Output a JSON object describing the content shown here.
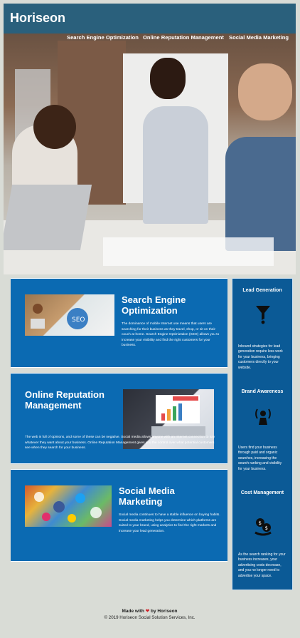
{
  "header": {
    "logo": "Horiseon",
    "nav": [
      {
        "label": "Search Engine Optimization"
      },
      {
        "label": "Online Reputation Management"
      },
      {
        "label": "Social Media Marketing"
      }
    ]
  },
  "sections": [
    {
      "title": "Search Engine Optimization",
      "body": "The dominance of mobile Internet use means that users are searching for their business as they travel, shop, or sit on their couch at home. Search Engine Optimization (SEO) allows you to increase your visibility and find the right customers for your business."
    },
    {
      "title": "Online Reputation Management",
      "body": "The web is full of opinions, and some of these can be negative. Social media allows anyone with an Internet connection to say whatever they want about your business. Online Reputation Management gives you the control over what potential customers see when they search for your business."
    },
    {
      "title": "Social Media Marketing",
      "body": "Social media continues to have a stable influence on buying habits. Social media marketing helps you determine which platforms are suited to your brand, using analytics to find the right markets and increase your lead generation."
    }
  ],
  "aside": [
    {
      "title": "Lead Generation",
      "icon": "lead-generation-icon",
      "text": "Inbound strategies for lead generation require less work for your business, bringing customers directly to your website."
    },
    {
      "title": "Brand Awareness",
      "icon": "brand-awareness-icon",
      "text": "Users find your business through paid and organic searches, increasing the search ranking and visibility for your business."
    },
    {
      "title": "Cost Management",
      "icon": "cost-management-icon",
      "text": "As the search ranking for your business increases, your advertising costs decrease, and you no longer need to advertise your space."
    }
  ],
  "footer": {
    "made_prefix": "Made with",
    "made_suffix": "by Horiseon",
    "copyright": "© 2019 Horiseon Social Solution Services, Inc."
  },
  "colors": {
    "header_bg": "#2a607c",
    "card_bg": "#0b6ab2",
    "aside_bg": "#0b5a96",
    "page_bg": "#d9dcd6",
    "heart": "#d2232a"
  }
}
